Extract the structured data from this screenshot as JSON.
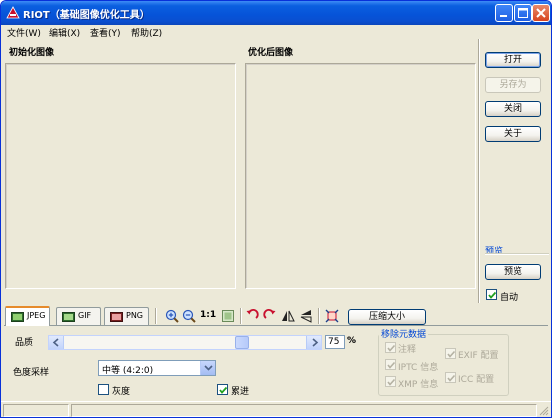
{
  "window": {
    "title": "RIOT（基础图像优化工具）"
  },
  "menu": {
    "items": [
      {
        "label": "文件(W)"
      },
      {
        "label": "编辑(X)"
      },
      {
        "label": "查看(Y)"
      },
      {
        "label": "帮助(Z)"
      }
    ]
  },
  "panels": {
    "original_label": "初始化图像",
    "optimized_label": "优化后图像"
  },
  "side_buttons": {
    "open": "打开",
    "save_as": "另存为",
    "close": "关闭",
    "about": "关于"
  },
  "preview": {
    "group_label": "预览",
    "button": "预览",
    "auto_label": "自动",
    "auto_checked": true
  },
  "tabs": [
    {
      "label": "JPEG",
      "active": true
    },
    {
      "label": "GIF",
      "active": false
    },
    {
      "label": "PNG",
      "active": false
    }
  ],
  "toolbar": {
    "zoom_label": "1:1",
    "compress_button": "压缩大小",
    "icons": [
      "zoom-in-icon",
      "zoom-out-icon",
      "fit-image-icon",
      "rotate-left-icon",
      "rotate-right-icon",
      "flip-horizontal-icon",
      "flip-vertical-icon",
      "crop-icon"
    ]
  },
  "quality": {
    "label": "品质",
    "value": "75",
    "unit": "%",
    "slider_fraction": 0.75
  },
  "chroma": {
    "label": "色度采样",
    "selected": "中等  (4:2:0)"
  },
  "options": {
    "grayscale_label": "灰度",
    "grayscale_checked": false,
    "progressive_label": "累进",
    "progressive_checked": true
  },
  "metadata": {
    "group_title": "移除元数据",
    "items": [
      {
        "label": "注释",
        "checked": true
      },
      {
        "label": "EXIF 配置",
        "checked": true
      },
      {
        "label": "IPTC 信息",
        "checked": true
      },
      {
        "label": "XMP 信息",
        "checked": true
      },
      {
        "label": "ICC 配置",
        "checked": true
      }
    ]
  },
  "colors": {
    "titlebar": "#0653d8",
    "window_bg": "#ece9d8",
    "group_label": "#0046d5",
    "tab_accent": "#e68b2c"
  }
}
